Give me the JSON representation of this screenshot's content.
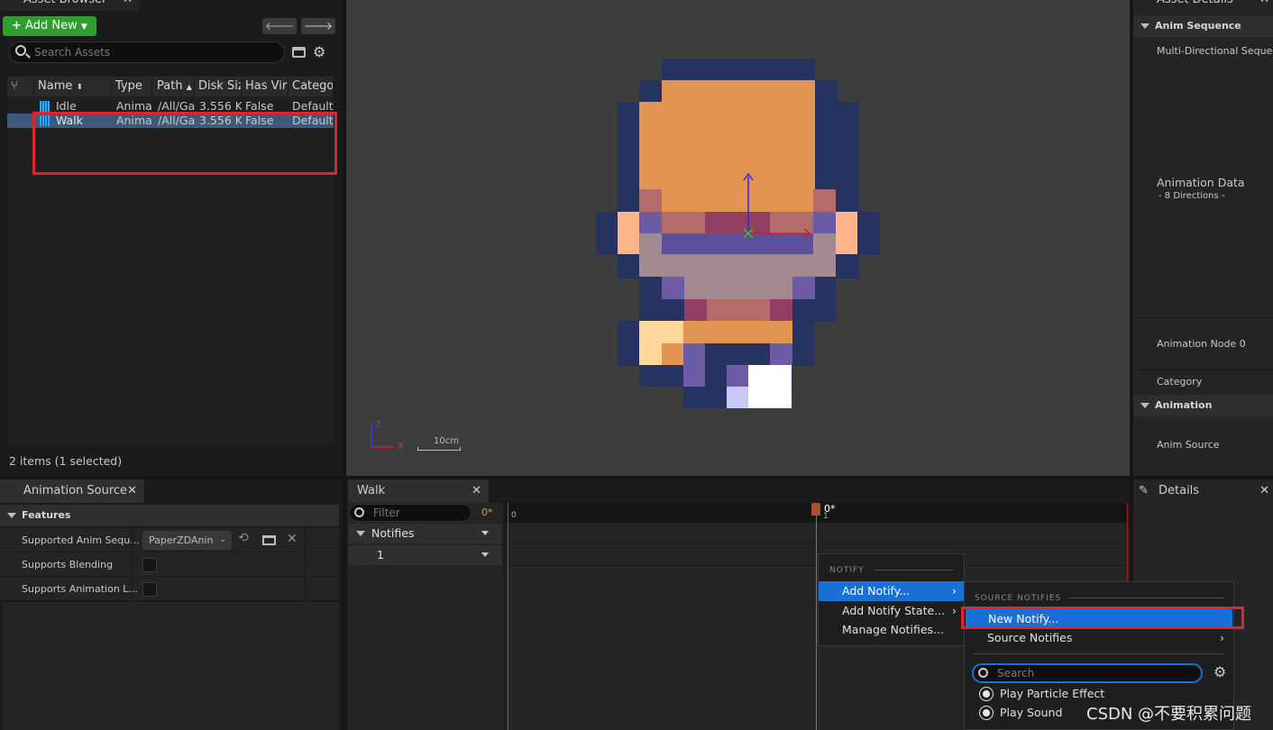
{
  "asset_browser": {
    "tab_title": "Asset Browser",
    "add_new": "Add New",
    "search_placeholder": "Search Assets",
    "columns": [
      "Name",
      "Type",
      "Path",
      "Disk Siz",
      "Has Virt",
      "Categor"
    ],
    "rows": [
      {
        "name": "Idle",
        "type": "Anima",
        "path": "/All/Ga",
        "size": "3.556 K",
        "virt": "False",
        "category": "Default"
      },
      {
        "name": "Walk",
        "type": "Anima",
        "path": "/All/Ga",
        "size": "3.556 K",
        "virt": "False",
        "category": "Default"
      }
    ],
    "status": "2 items (1 selected)"
  },
  "viewport": {
    "scale_label": "10cm",
    "axis_z": "Z",
    "axis_x": "X"
  },
  "asset_details": {
    "tab_title": "Asset Details",
    "section_anim_sequence": "Anim Sequence",
    "multi_directional": "Multi-Directional Sequence",
    "animation_data": "Animation Data",
    "directions": "- 8 Directions -",
    "animation_node": "Animation Node 0",
    "category": "Category",
    "section_animation": "Animation",
    "anim_source": "Anim Source"
  },
  "animation_source": {
    "tab_title": "Animation Source",
    "section_features": "Features",
    "rows": [
      {
        "label": "Supported Anim Sequ...",
        "value": "PaperZDAnin"
      },
      {
        "label": "Supports Blending"
      },
      {
        "label": "Supports Animation L..."
      }
    ]
  },
  "timeline": {
    "tab_title": "Walk",
    "filter_placeholder": "Filter",
    "frame_marker": "0*",
    "ruler_start": "0",
    "ruler_playhead": "0*",
    "ruler_playhead_sub": "1",
    "track_notifies": "Notifies",
    "track_1": "1"
  },
  "details": {
    "tab_title": "Details"
  },
  "context_menu": {
    "heading": "NOTIFY",
    "items": [
      "Add Notify...",
      "Add Notify State...",
      "Manage Notifies..."
    ]
  },
  "submenu": {
    "heading": "SOURCE NOTIFIES",
    "new_notify": "New Notify...",
    "source_notifies": "Source Notifies",
    "search_placeholder": "Search",
    "items": [
      "Play Particle Effect",
      "Play Sound"
    ]
  },
  "watermark": "CSDN @不要积累问题",
  "colors": {
    "highlight": "#1a6fd6",
    "red_box": "#e0242b",
    "add_new_green": "#2f9e2f",
    "selected_row": "#3e5a7a"
  }
}
